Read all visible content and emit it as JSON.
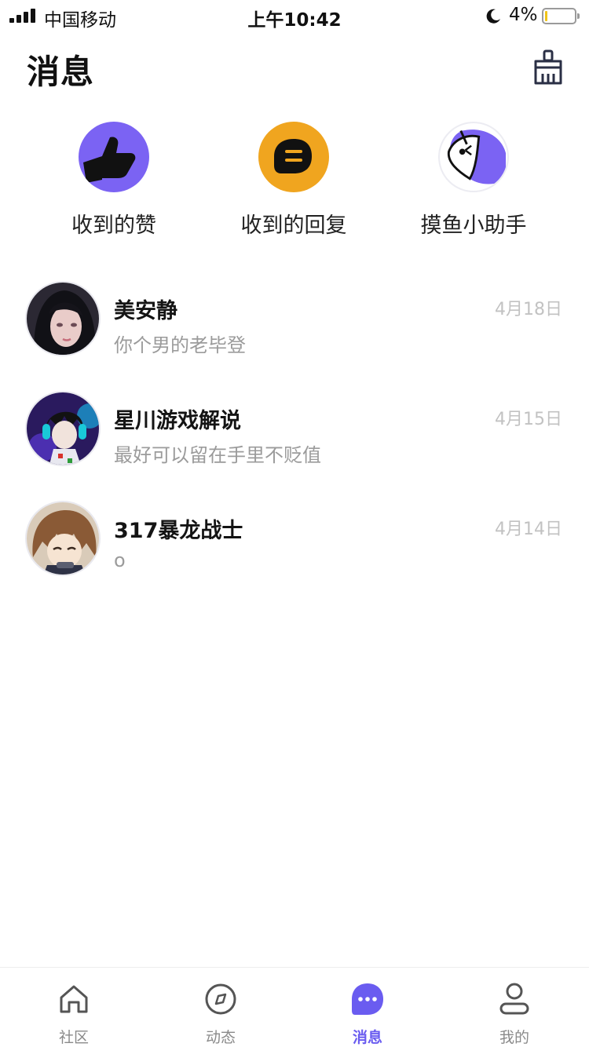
{
  "status_bar": {
    "carrier": "中国移动",
    "time": "上午10:42",
    "battery_percent": "4%",
    "battery_level": 0.04,
    "icons": [
      "signal-icon",
      "moon-icon",
      "battery-icon"
    ]
  },
  "header": {
    "title": "消息",
    "action_icon": "broom-icon"
  },
  "quick_entries": [
    {
      "label": "收到的赞",
      "icon": "thumbs-up-icon",
      "color": "#7b63f3"
    },
    {
      "label": "收到的回复",
      "icon": "reply-bubble-icon",
      "color": "#f0a51f"
    },
    {
      "label": "摸鱼小助手",
      "icon": "fish-assistant-icon",
      "color": "#7b63f3"
    }
  ],
  "conversations": [
    {
      "name": "美安静",
      "preview": "你个男的老毕登",
      "date": "4月18日",
      "avatar": "avatar-dark-hair-girl"
    },
    {
      "name": "星川游戏解说",
      "preview": "最好可以留在手里不贬值",
      "date": "4月15日",
      "avatar": "avatar-anime-headphones"
    },
    {
      "name": "317暴龙战士",
      "preview": "o",
      "date": "4月14日",
      "avatar": "avatar-anime-brown-hair"
    }
  ],
  "tab_bar": {
    "active": "消息",
    "accent_color": "#6a5cf0",
    "tabs": [
      {
        "label": "社区",
        "icon": "home-icon"
      },
      {
        "label": "动态",
        "icon": "compass-icon"
      },
      {
        "label": "消息",
        "icon": "chat-dots-icon"
      },
      {
        "label": "我的",
        "icon": "profile-icon"
      }
    ]
  }
}
